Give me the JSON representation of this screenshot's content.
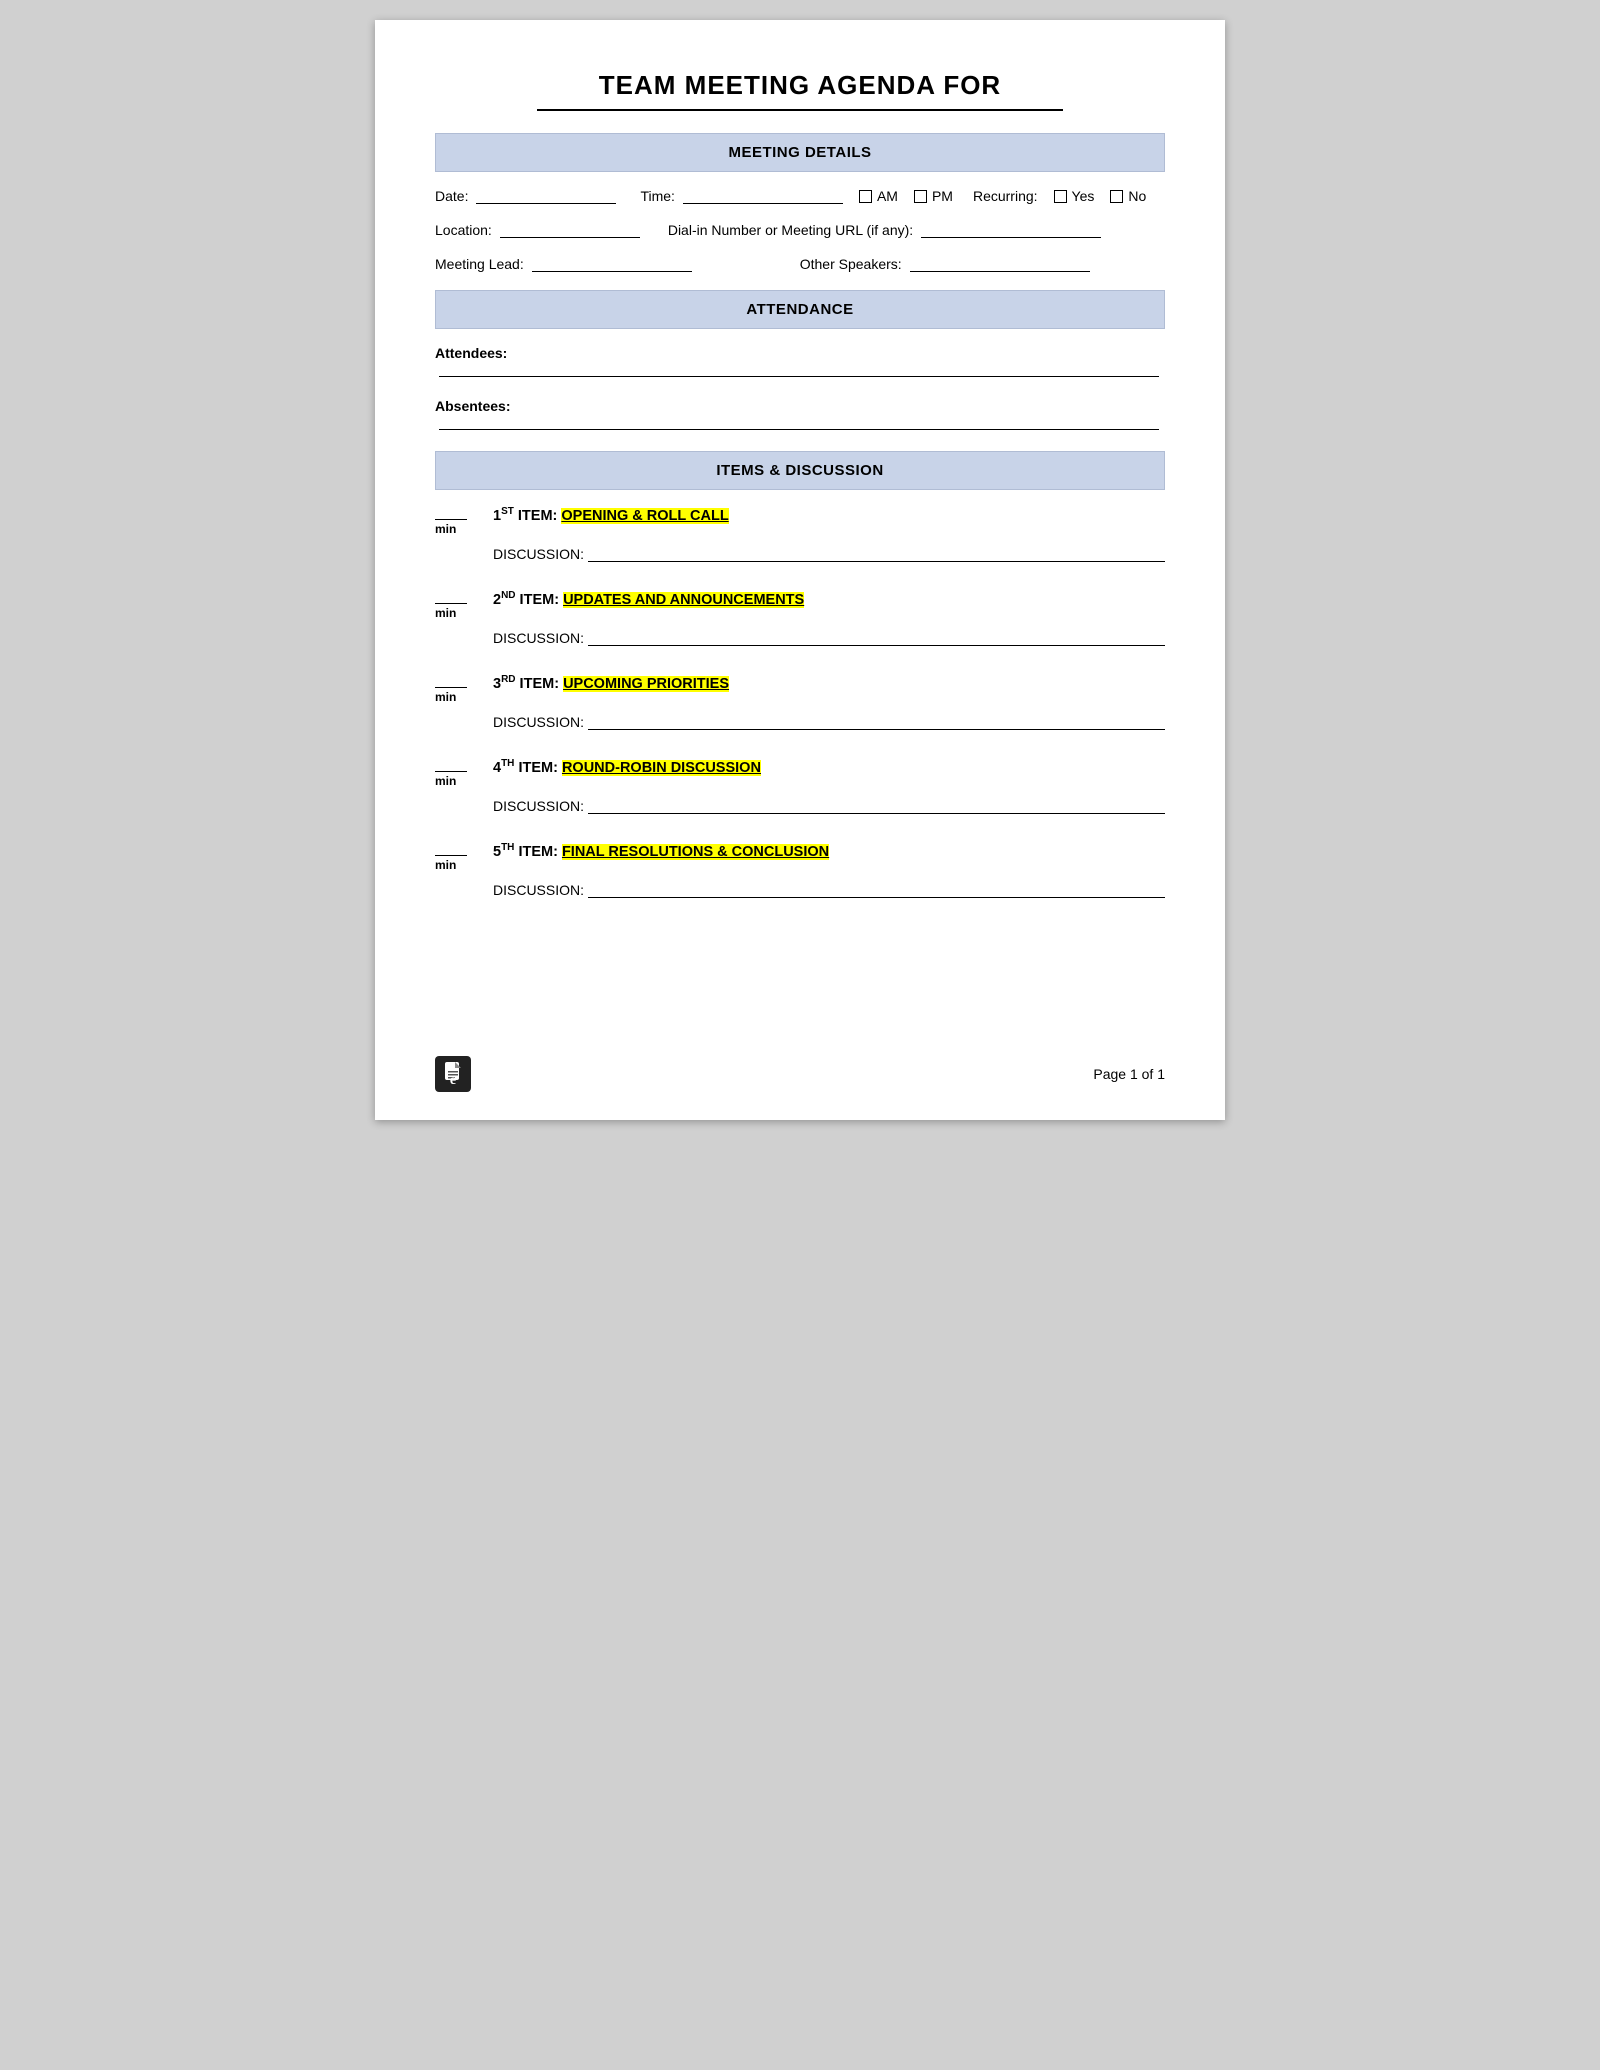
{
  "title": "TEAM MEETING AGENDA FOR",
  "sections": {
    "meeting_details": {
      "header": "MEETING DETAILS",
      "rows": {
        "row1": {
          "date_label": "Date:",
          "time_label": "Time:",
          "am_label": "AM",
          "pm_label": "PM",
          "recurring_label": "Recurring:",
          "yes_label": "Yes",
          "no_label": "No"
        },
        "row2": {
          "location_label": "Location:",
          "dialin_label": "Dial-in Number or Meeting URL (if any):"
        },
        "row3": {
          "lead_label": "Meeting Lead:",
          "speakers_label": "Other Speakers:"
        }
      }
    },
    "attendance": {
      "header": "ATTENDANCE",
      "attendees_label": "Attendees:",
      "absentees_label": "Absentees"
    },
    "items_discussion": {
      "header": "ITEMS & DISCUSSION",
      "items": [
        {
          "ordinal": "1",
          "ordinal_sup": "ST",
          "item_label": "ITEM:",
          "keyword": "OPENING & ROLL CALL",
          "min_label": "min",
          "discussion_label": "DISCUSSION:"
        },
        {
          "ordinal": "2",
          "ordinal_sup": "ND",
          "item_label": "ITEM:",
          "keyword": "UPDATES AND ANNOUNCEMENTS",
          "min_label": "min",
          "discussion_label": "DISCUSSION:"
        },
        {
          "ordinal": "3",
          "ordinal_sup": "RD",
          "item_label": "ITEM:",
          "keyword": "UPCOMING PRIORITIES",
          "min_label": "min",
          "discussion_label": "DISCUSSION:"
        },
        {
          "ordinal": "4",
          "ordinal_sup": "TH",
          "item_label": "ITEM:",
          "keyword": "ROUND-ROBIN DISCUSSION",
          "min_label": "min",
          "discussion_label": "DISCUSSION:"
        },
        {
          "ordinal": "5",
          "ordinal_sup": "TH",
          "item_label": "ITEM:",
          "keyword": "FINAL RESOLUTIONS & CONCLUSION",
          "min_label": "min",
          "discussion_label": "DISCUSSION:"
        }
      ]
    }
  },
  "footer": {
    "page_text": "Page 1 of 1"
  }
}
